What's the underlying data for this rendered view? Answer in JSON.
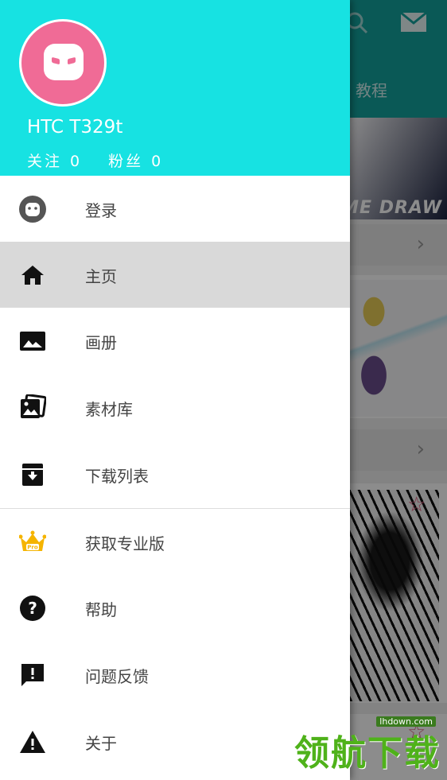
{
  "background": {
    "tab_label": "教程",
    "banner_text": "ME DRAW",
    "icons": [
      "search-icon",
      "mail-icon",
      "chevron-right-icon",
      "star-outline-icon"
    ]
  },
  "drawer": {
    "profile": {
      "name": "HTC T329t",
      "following_label": "关注",
      "following_count": "0",
      "followers_label": "粉丝",
      "followers_count": "0"
    },
    "items": [
      {
        "label": "登录",
        "icon": "robot-face-icon"
      },
      {
        "label": "主页",
        "icon": "home-icon",
        "selected": true
      },
      {
        "label": "画册",
        "icon": "image-icon"
      },
      {
        "label": "素材库",
        "icon": "photo-library-icon"
      },
      {
        "label": "下载列表",
        "icon": "download-box-icon"
      },
      {
        "label": "获取专业版",
        "icon": "crown-pro-icon"
      },
      {
        "label": "帮助",
        "icon": "help-icon"
      },
      {
        "label": "问题反馈",
        "icon": "feedback-icon"
      },
      {
        "label": "关于",
        "icon": "warning-icon"
      }
    ]
  },
  "watermark": {
    "site": "lhdown.com",
    "text": "领航下载"
  },
  "colors": {
    "header": "#17e2e2",
    "avatar": "#f06b96",
    "crown": "#f5b400",
    "selected_row": "#d9d9d9"
  }
}
